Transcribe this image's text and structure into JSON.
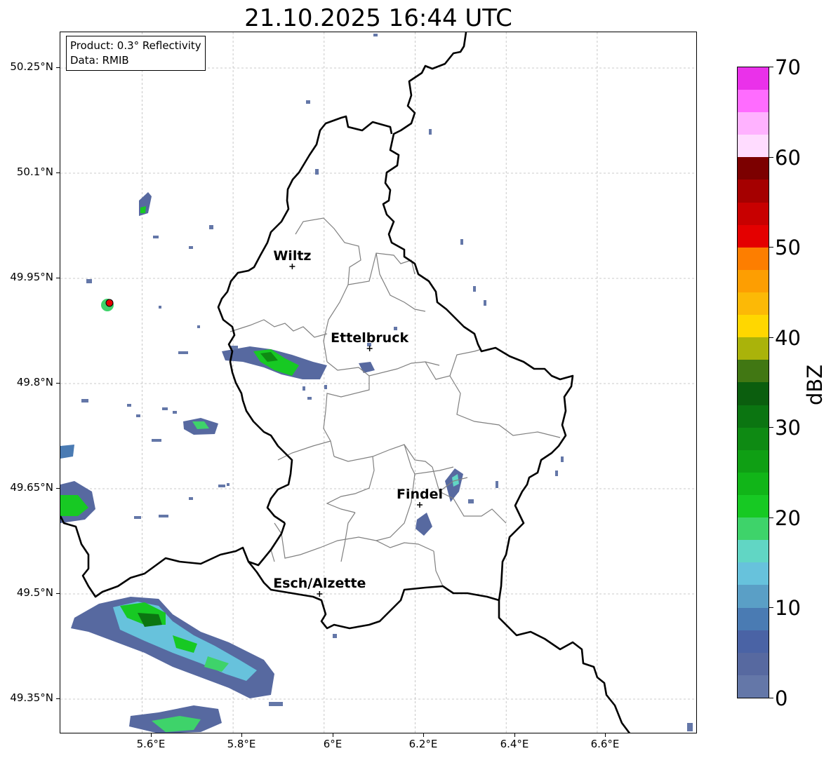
{
  "title": "21.10.2025 16:44 UTC",
  "info": {
    "product": "Product: 0.3° Reflectivity",
    "data": "Data: RMIB"
  },
  "axes": {
    "lon_ticks": [
      "5.6°E",
      "5.8°E",
      "6°E",
      "6.2°E",
      "6.4°E",
      "6.6°E"
    ],
    "lat_ticks": [
      "50.25°N",
      "50.1°N",
      "49.95°N",
      "49.8°N",
      "49.65°N",
      "49.5°N",
      "49.35°N"
    ],
    "grid": true
  },
  "cities": [
    {
      "name": "Wiltz",
      "lon": 5.93,
      "lat": 49.967
    },
    {
      "name": "Ettelbruck",
      "lon": 6.1,
      "lat": 49.85
    },
    {
      "name": "Findel",
      "lon": 6.21,
      "lat": 49.627
    },
    {
      "name": "Esch/Alzette",
      "lon": 5.99,
      "lat": 49.5
    }
  ],
  "colorbar": {
    "label": "dBZ",
    "ticks": [
      "0",
      "10",
      "20",
      "30",
      "40",
      "50",
      "60",
      "70"
    ],
    "min": 0,
    "max": 70,
    "colors": [
      "#6477a8",
      "#5769a0",
      "#4a63a5",
      "#4a7bb3",
      "#5a9fc6",
      "#67c2dc",
      "#61d6c4",
      "#3ed36a",
      "#17c923",
      "#11b518",
      "#0f9f14",
      "#0e8a13",
      "#0b7511",
      "#0b5e0e",
      "#417713",
      "#aab30a",
      "#ffd700",
      "#fcb906",
      "#fd9e02",
      "#fd7e00",
      "#e40000",
      "#c80000",
      "#a50000",
      "#7c0000",
      "#ffdcff",
      "#ffb2ff",
      "#ff6cff",
      "#ea31ea"
    ]
  }
}
